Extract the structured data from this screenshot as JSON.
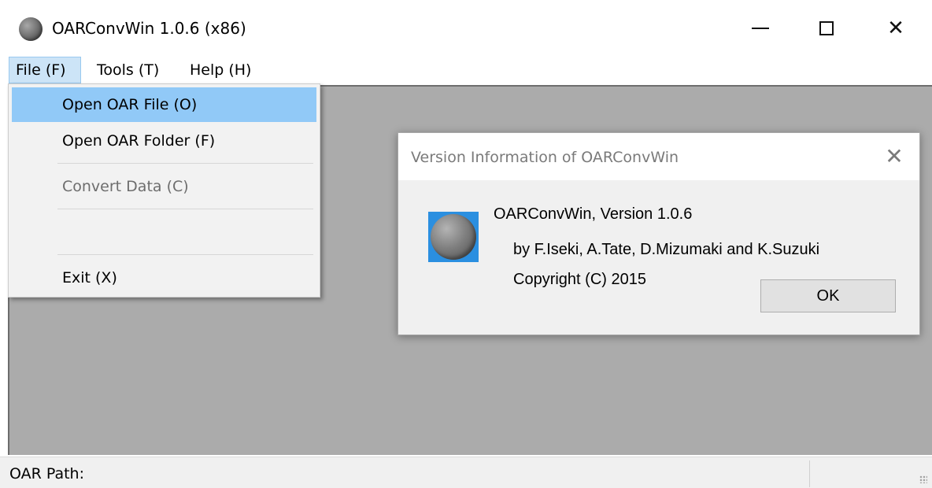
{
  "window": {
    "title": "OARConvWin 1.0.6 (x86)",
    "icon": "sphere-icon",
    "controls": {
      "close_glyph": "✕"
    }
  },
  "menubar": {
    "items": [
      {
        "label": "File (F)"
      },
      {
        "label": "Tools (T)"
      },
      {
        "label": "Help (H)"
      }
    ]
  },
  "file_menu": {
    "items": [
      {
        "label": "Open OAR File (O)",
        "state": "highlighted"
      },
      {
        "label": "Open OAR Folder (F)",
        "state": "enabled"
      },
      {
        "label": "Convert Data (C)",
        "state": "disabled"
      },
      {
        "label": "",
        "state": "disabled"
      },
      {
        "label": "Exit (X)",
        "state": "enabled"
      }
    ]
  },
  "dialog": {
    "title": "Version Information of OARConvWin",
    "close_glyph": "✕",
    "lines": [
      "OARConvWin, Version 1.0.6",
      "by F.Iseki, A.Tate, D.Mizumaki and K.Suzuki",
      "Copyright (C) 2015"
    ],
    "ok_label": "OK"
  },
  "statusbar": {
    "text": "OAR Path:"
  },
  "colors": {
    "client_bg": "#ababab",
    "menu_highlight": "#91c9f7",
    "icon_bg": "#2b8fe0"
  }
}
